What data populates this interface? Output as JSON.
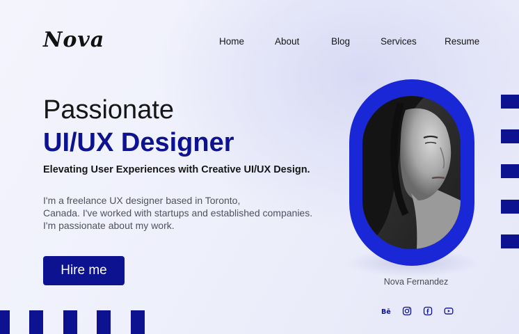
{
  "brand": {
    "logo": "Nova"
  },
  "nav": {
    "items": [
      {
        "label": "Home"
      },
      {
        "label": "About"
      },
      {
        "label": "Blog"
      },
      {
        "label": "Services"
      },
      {
        "label": "Resume"
      }
    ]
  },
  "hero": {
    "line1": "Passionate",
    "line2": "UI/UX Designer",
    "tagline": "Elevating User Experiences with Creative UI/UX Design.",
    "bio": [
      "I'm a freelance UX designer based in Toronto,",
      "Canada. I've worked with startups and established companies.",
      "I'm passionate about my work."
    ],
    "cta_label": "Hire me"
  },
  "profile": {
    "name": "Nova Fernandez"
  },
  "social": {
    "icons": [
      "behance-icon",
      "instagram-icon",
      "facebook-icon",
      "youtube-icon"
    ]
  },
  "colors": {
    "accent": "#0c1290",
    "frame": "#1a27d6",
    "text": "#161616",
    "muted": "#4f5161"
  }
}
